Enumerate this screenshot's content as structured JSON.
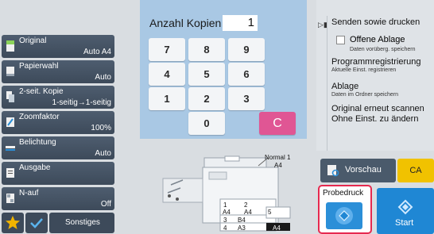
{
  "left_settings": [
    {
      "label": "Original",
      "value": "Auto  A4",
      "icon": "original-icon"
    },
    {
      "label": "Papierwahl",
      "value": "Auto",
      "icon": "paper-icon"
    },
    {
      "label": "2-seit. Kopie",
      "value": "1-seitig→1-seitig",
      "icon": "duplex-icon"
    },
    {
      "label": "Zoomfaktor",
      "value": "100%",
      "icon": "zoom-icon"
    },
    {
      "label": "Belichtung",
      "value": "Auto",
      "icon": "exposure-icon"
    },
    {
      "label": "Ausgabe",
      "value": "",
      "icon": "output-icon"
    },
    {
      "label": "N-auf",
      "value": "Off",
      "icon": "n-up-icon"
    }
  ],
  "bottom_bar": {
    "favorite_icon": "star-icon",
    "check_icon": "check-icon",
    "others_label": "Sonstiges"
  },
  "copies": {
    "label": "Anzahl Kopien",
    "value": "1"
  },
  "keypad": {
    "keys": [
      "7",
      "8",
      "9",
      "4",
      "5",
      "6",
      "1",
      "2",
      "3",
      "0"
    ],
    "clear": "C"
  },
  "right_panel": {
    "send_and_print": "Senden sowie drucken",
    "offene_ablage": "Offene Ablage",
    "offene_ablage_sub": "Daten vorüberg. speichern",
    "program_reg": "Programmregistrierung",
    "program_reg_sub": "Aktuelle Einst. registrieren",
    "ablage": "Ablage",
    "ablage_sub": "Daten im Ordner speichern",
    "rescan_line1": "Original erneut scannen",
    "rescan_line2": "Ohne Einst. zu ändern"
  },
  "preview": {
    "label": "Vorschau"
  },
  "ca_label": "CA",
  "probedruck": {
    "label": "Probedruck"
  },
  "start": {
    "label": "Start"
  },
  "machine": {
    "original_label_1": "Normal 1",
    "original_label_2": "A4",
    "trays": [
      {
        "num": "1",
        "size": "A4"
      },
      {
        "num": "2",
        "size": "A4"
      },
      {
        "num": "3",
        "size": "B4"
      },
      {
        "num": "4",
        "size": "A3"
      },
      {
        "num": "5",
        "size": ""
      }
    ],
    "bypass_size": "A4"
  },
  "colors": {
    "keypad_bg": "#a9c8e4",
    "clear_key": "#e05694",
    "ca_button": "#f1c200",
    "start_button": "#1f87d4",
    "highlight_frame": "#e6294f"
  }
}
